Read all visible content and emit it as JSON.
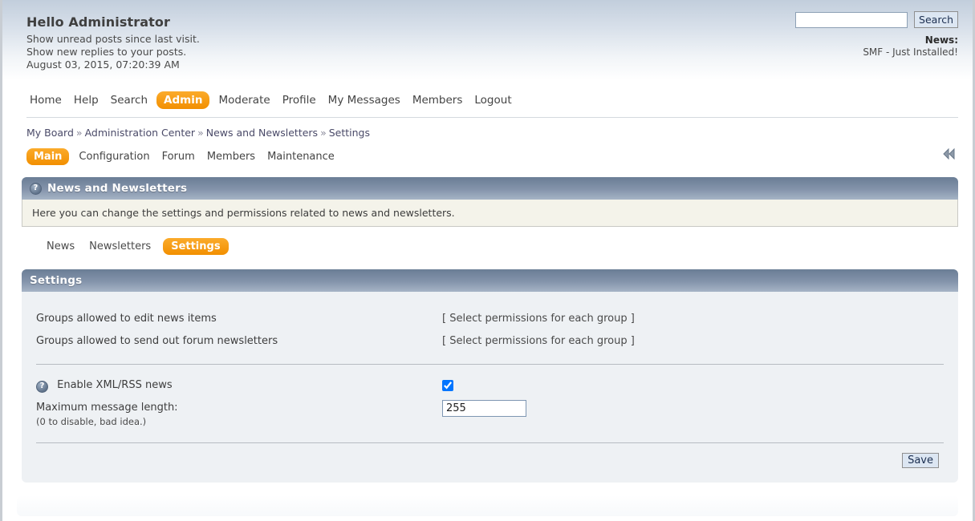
{
  "header": {
    "greeting": "Hello Administrator",
    "line_unread": "Show unread posts since last visit.",
    "line_replies": "Show new replies to your posts.",
    "datetime": "August 03, 2015, 07:20:39 AM",
    "search_value": "",
    "search_placeholder": "",
    "search_button": "Search",
    "news_label": "News:",
    "news_text": "SMF - Just Installed!"
  },
  "mainnav": {
    "items": [
      {
        "label": "Home",
        "active": false
      },
      {
        "label": "Help",
        "active": false
      },
      {
        "label": "Search",
        "active": false
      },
      {
        "label": "Admin",
        "active": true
      },
      {
        "label": "Moderate",
        "active": false
      },
      {
        "label": "Profile",
        "active": false
      },
      {
        "label": "My Messages",
        "active": false
      },
      {
        "label": "Members",
        "active": false
      },
      {
        "label": "Logout",
        "active": false
      }
    ]
  },
  "breadcrumb": {
    "separator": "»",
    "items": [
      "My Board",
      "Administration Center",
      "News and Newsletters",
      "Settings"
    ]
  },
  "admin_tabs": {
    "items": [
      {
        "label": "Main",
        "active": true
      },
      {
        "label": "Configuration",
        "active": false
      },
      {
        "label": "Forum",
        "active": false
      },
      {
        "label": "Members",
        "active": false
      },
      {
        "label": "Maintenance",
        "active": false
      }
    ],
    "collapse_icon": "double-chevron-left-icon"
  },
  "section": {
    "help_icon": "question-mark-icon",
    "title": "News and Newsletters",
    "description": "Here you can change the settings and permissions related to news and newsletters."
  },
  "subtabs": {
    "items": [
      {
        "label": "News",
        "active": false
      },
      {
        "label": "Newsletters",
        "active": false
      },
      {
        "label": "Settings",
        "active": true
      }
    ]
  },
  "settings": {
    "panel_title": "Settings",
    "rows": [
      {
        "label": "Groups allowed to edit news items",
        "value": "[ Select permissions for each group ]"
      },
      {
        "label": "Groups allowed to send out forum newsletters",
        "value": "[ Select permissions for each group ]"
      }
    ],
    "enable_rss": {
      "help_icon": "question-mark-icon",
      "label": "Enable XML/RSS news",
      "checked": true
    },
    "max_length": {
      "label": "Maximum message length:",
      "sublabel": "(0 to disable, bad idea.)",
      "value": "255"
    },
    "save_label": "Save"
  },
  "colors": {
    "accent_orange": "#f28f00",
    "panel_header_dark": "#6a7d95",
    "panel_header_light": "#a6b4c6",
    "panel_body": "#eef1f4",
    "info_box_bg": "#f4f3ea",
    "header_gradient_top": "#c2cedc"
  }
}
